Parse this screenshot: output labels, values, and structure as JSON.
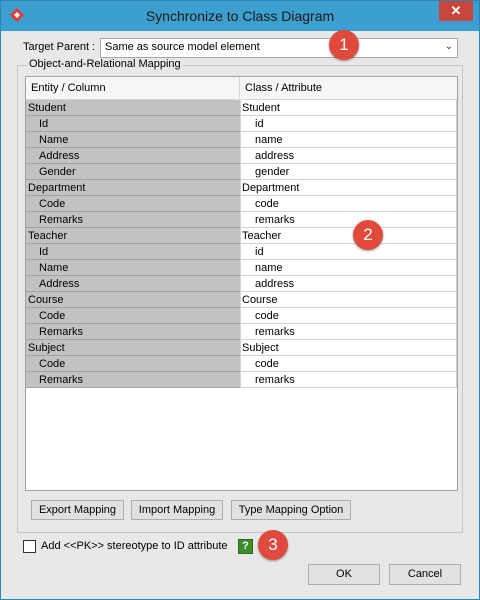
{
  "window": {
    "title": "Synchronize to Class Diagram",
    "close_glyph": "✕"
  },
  "target_parent": {
    "label": "Target Parent :",
    "value": "Same as source model element"
  },
  "mapping": {
    "group_title": "Object-and-Relational Mapping",
    "columns": [
      "Entity / Column",
      "Class / Attribute"
    ],
    "rows": [
      {
        "kind": "parent",
        "entity": "Student",
        "class": "Student"
      },
      {
        "kind": "child",
        "entity": "Id",
        "class": "id"
      },
      {
        "kind": "child",
        "entity": "Name",
        "class": "name"
      },
      {
        "kind": "child",
        "entity": "Address",
        "class": "address"
      },
      {
        "kind": "child",
        "entity": "Gender",
        "class": "gender"
      },
      {
        "kind": "parent",
        "entity": "Department",
        "class": "Department"
      },
      {
        "kind": "child",
        "entity": "Code",
        "class": "code"
      },
      {
        "kind": "child",
        "entity": "Remarks",
        "class": "remarks"
      },
      {
        "kind": "parent",
        "entity": "Teacher",
        "class": "Teacher"
      },
      {
        "kind": "child",
        "entity": "Id",
        "class": "id"
      },
      {
        "kind": "child",
        "entity": "Name",
        "class": "name"
      },
      {
        "kind": "child",
        "entity": "Address",
        "class": "address"
      },
      {
        "kind": "parent",
        "entity": "Course",
        "class": "Course"
      },
      {
        "kind": "child",
        "entity": "Code",
        "class": "code"
      },
      {
        "kind": "child",
        "entity": "Remarks",
        "class": "remarks"
      },
      {
        "kind": "parent",
        "entity": "Subject",
        "class": "Subject"
      },
      {
        "kind": "child",
        "entity": "Code",
        "class": "code"
      },
      {
        "kind": "child",
        "entity": "Remarks",
        "class": "remarks"
      }
    ]
  },
  "buttons": {
    "export": "Export Mapping",
    "import": "Import Mapping",
    "type_option": "Type Mapping Option",
    "ok": "OK",
    "cancel": "Cancel"
  },
  "pk_option": {
    "label": "Add <<PK>> stereotype to ID attribute",
    "checked": false,
    "help_glyph": "?"
  },
  "markers": [
    "1",
    "2",
    "3"
  ],
  "colors": {
    "titlebar": "#3d9fcf",
    "marker": "#e04a3c",
    "entity_cell": "#c2c2c2",
    "help": "#3b8e2a"
  }
}
